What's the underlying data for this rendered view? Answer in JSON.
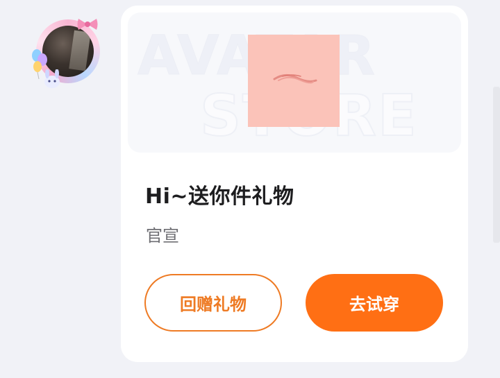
{
  "avatar": {
    "name": "user-avatar",
    "frame": "pink-bow-balloon-frame"
  },
  "card": {
    "banner": {
      "watermark_line1": "AVATAR",
      "watermark_line2": "STORE"
    },
    "title": "Hi~送你件礼物",
    "subtitle": "官宣",
    "buttons": {
      "return_gift": "回赠礼物",
      "try_on": "去试穿"
    }
  },
  "colors": {
    "accent": "#ff6f14",
    "outline": "#ee7a23",
    "sticker": "#fbc3b9",
    "background": "#f1f2f7"
  }
}
